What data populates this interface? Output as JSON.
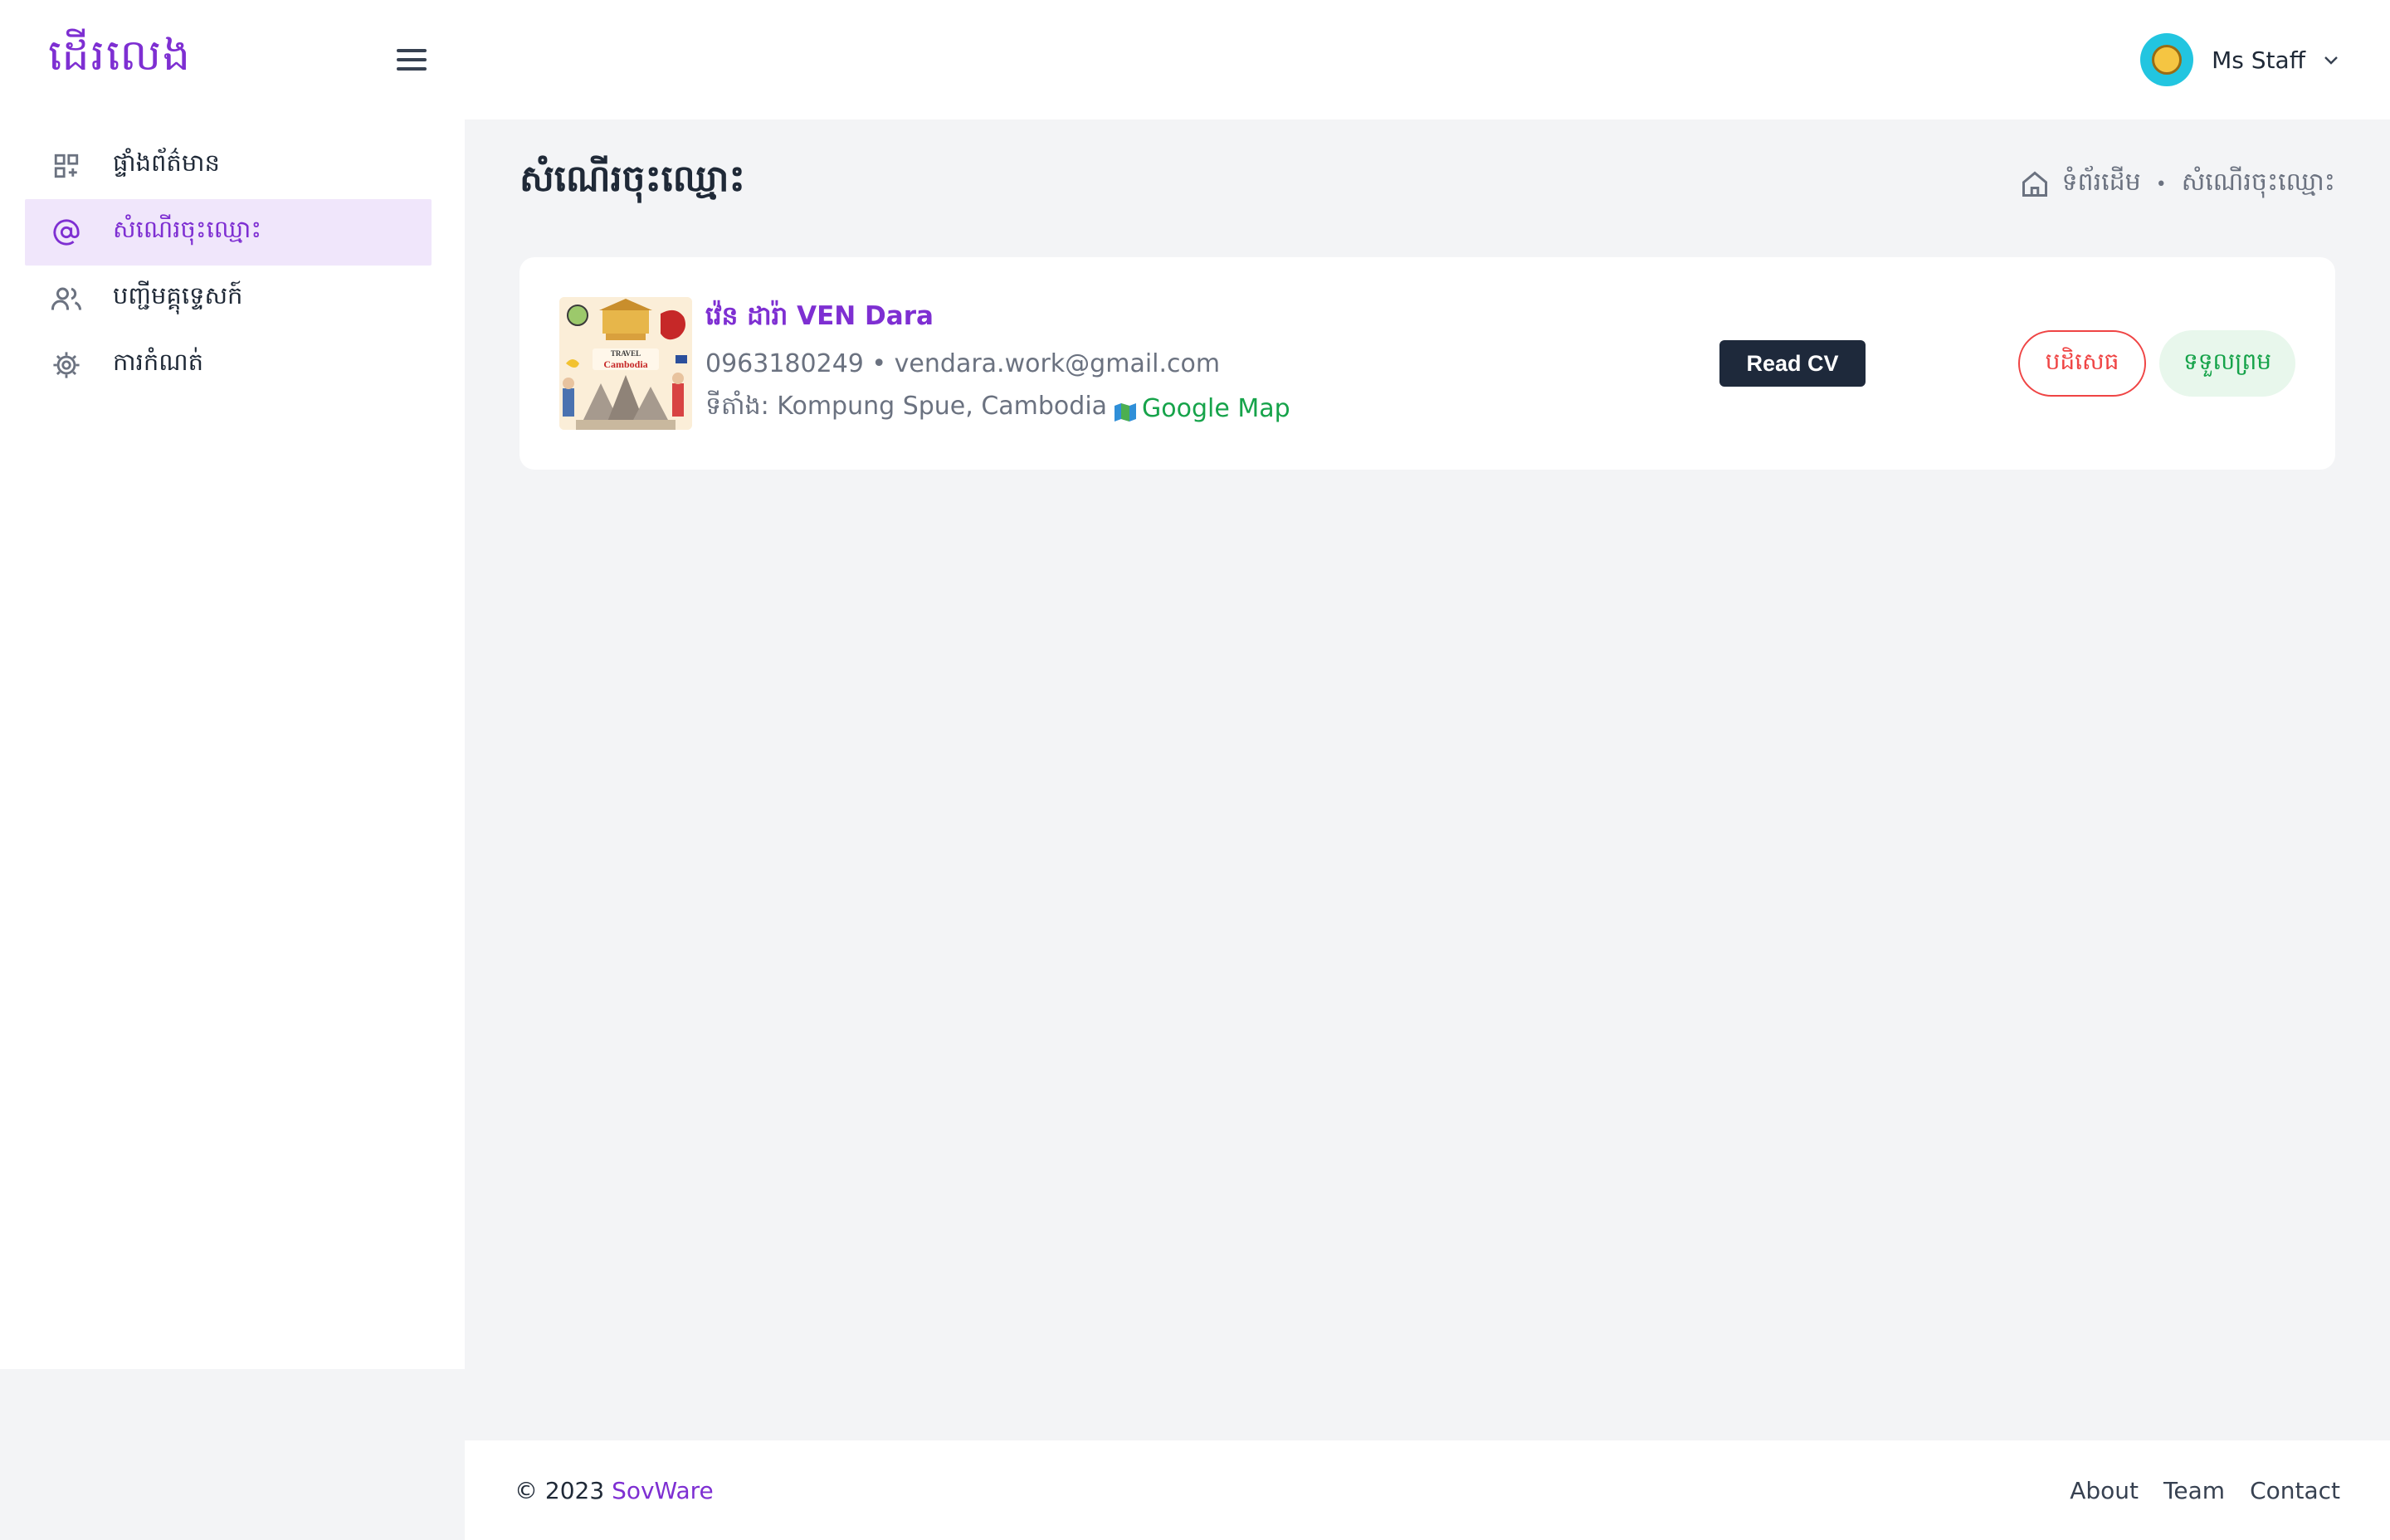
{
  "sidebar": {
    "logo": "ដើរលេង",
    "menu_icon": "hamburger-icon",
    "items": [
      {
        "label": "ផ្ទាំងព័ត៌មាន",
        "icon": "dashboard-icon",
        "active": false
      },
      {
        "label": "សំណើរចុះឈ្មោះ",
        "icon": "at-icon",
        "active": true
      },
      {
        "label": "បញ្ជីមគ្គុទ្ទេសក៍",
        "icon": "users-icon",
        "active": false
      },
      {
        "label": "ការកំណត់",
        "icon": "gear-icon",
        "active": false
      }
    ]
  },
  "header": {
    "user_name": "Ms Staff",
    "chevron": "⌄"
  },
  "page": {
    "title": "សំណើរចុះឈ្មោះ",
    "breadcrumb": {
      "home": "ទំព័រដើម",
      "separator": "•",
      "current": "សំណើរចុះឈ្មោះ"
    }
  },
  "request": {
    "name": "វ៉េន ដារ៉ា VEN Dara",
    "phone": "0963180249",
    "separator": "•",
    "email": "vendara.work@gmail.com",
    "location_label": "ទីតាំង: Kompung Spue, Cambodia",
    "map_link": "Google Map",
    "thumb_text_1": "TRAVEL",
    "thumb_text_2": "Cambodia",
    "read_cv": "Read CV",
    "reject": "បដិសេធ",
    "accept": "ទទួលព្រម"
  },
  "footer": {
    "copyright": "© 2023",
    "brand": "SovWare",
    "links": [
      "About",
      "Team",
      "Contact"
    ]
  },
  "colors": {
    "accent": "#7e2fd2",
    "reject": "#ef4444",
    "accept": "#16a34a",
    "dark_button": "#1e293b"
  }
}
